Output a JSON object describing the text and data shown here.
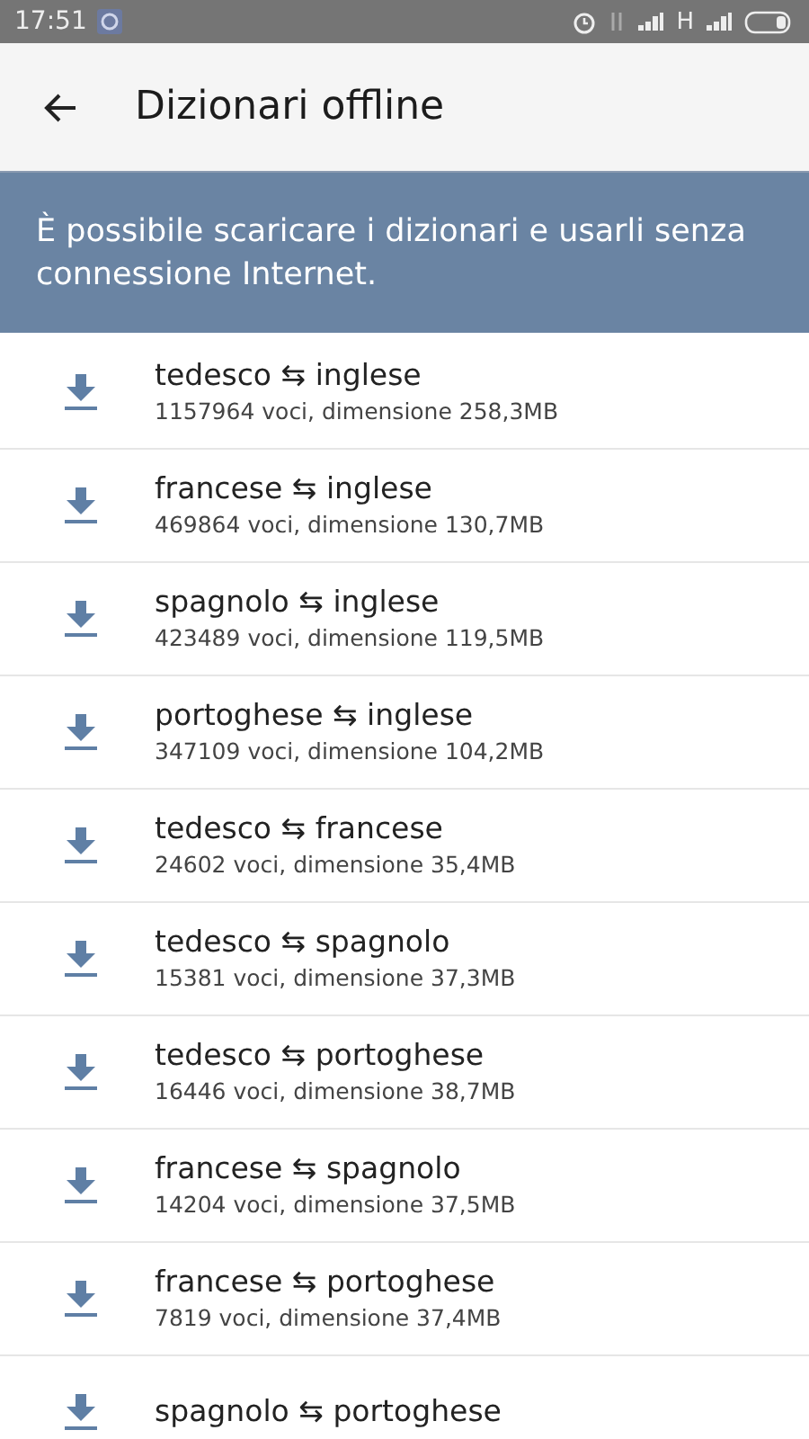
{
  "status_bar": {
    "time": "17:51",
    "network": "H"
  },
  "app_bar": {
    "title": "Dizionari offline"
  },
  "banner": {
    "text": "È possibile scaricare i dizionari e usarli senza connessione Internet."
  },
  "dictionaries": [
    {
      "title": "tedesco ⇆ inglese",
      "details": "1157964 voci, dimensione 258,3MB"
    },
    {
      "title": "francese ⇆ inglese",
      "details": "469864 voci, dimensione 130,7MB"
    },
    {
      "title": "spagnolo ⇆ inglese",
      "details": "423489 voci, dimensione 119,5MB"
    },
    {
      "title": "portoghese ⇆ inglese",
      "details": "347109 voci, dimensione 104,2MB"
    },
    {
      "title": "tedesco ⇆ francese",
      "details": "24602 voci, dimensione 35,4MB"
    },
    {
      "title": "tedesco ⇆ spagnolo",
      "details": "15381 voci, dimensione 37,3MB"
    },
    {
      "title": "tedesco ⇆ portoghese",
      "details": "16446 voci, dimensione 38,7MB"
    },
    {
      "title": "francese ⇆ spagnolo",
      "details": "14204 voci, dimensione 37,5MB"
    },
    {
      "title": "francese ⇆ portoghese",
      "details": "7819 voci, dimensione 37,4MB"
    },
    {
      "title": "spagnolo ⇆ portoghese"
    }
  ]
}
